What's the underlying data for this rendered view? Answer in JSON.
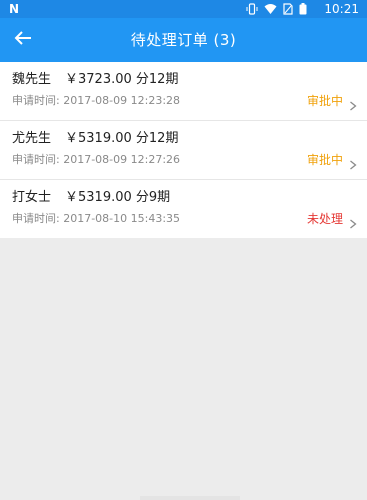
{
  "status_bar": {
    "carrier_logo": "N",
    "time": "10:21",
    "icons": [
      "vibrate-icon",
      "wifi-icon",
      "sim-icon",
      "battery-icon"
    ]
  },
  "app_bar": {
    "title": "待处理订单 (3)",
    "back_icon": "arrow-left-icon"
  },
  "orders": [
    {
      "name": "魏先生",
      "amount": "￥3723.00 分12期",
      "date_label": "申请时间:",
      "date": "2017-08-09 12:23:28",
      "status": "审批中",
      "status_color": "#f0a10a"
    },
    {
      "name": "尤先生",
      "amount": "￥5319.00 分12期",
      "date_label": "申请时间:",
      "date": "2017-08-09 12:27:26",
      "status": "审批中",
      "status_color": "#f0a10a"
    },
    {
      "name": "打女士",
      "amount": "￥5319.00 分9期",
      "date_label": "申请时间:",
      "date": "2017-08-10 15:43:35",
      "status": "未处理",
      "status_color": "#e53935"
    }
  ],
  "colors": {
    "status_bar": "#1e88e5",
    "app_bar": "#2196f3",
    "background": "#ececec"
  }
}
